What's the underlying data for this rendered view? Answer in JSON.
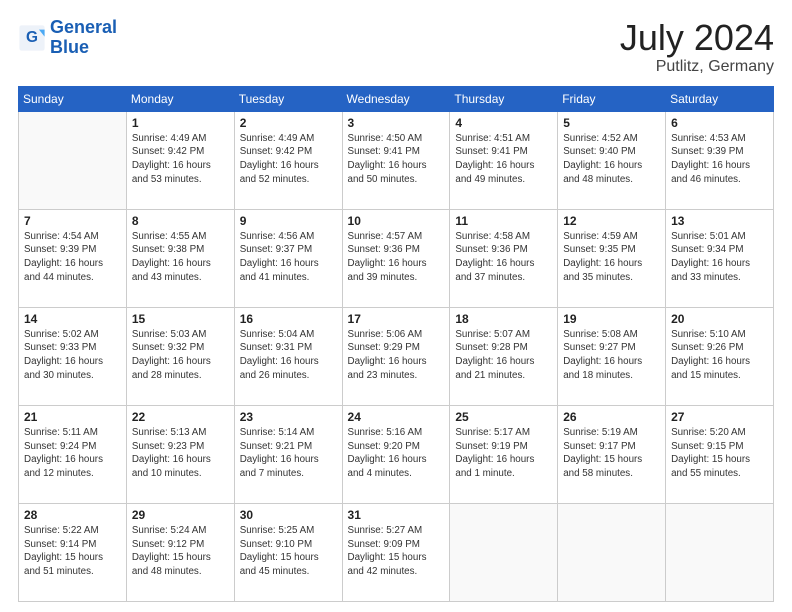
{
  "header": {
    "logo_line1": "General",
    "logo_line2": "Blue",
    "month_year": "July 2024",
    "location": "Putlitz, Germany"
  },
  "weekdays": [
    "Sunday",
    "Monday",
    "Tuesday",
    "Wednesday",
    "Thursday",
    "Friday",
    "Saturday"
  ],
  "weeks": [
    [
      {
        "day": "",
        "info": ""
      },
      {
        "day": "1",
        "info": "Sunrise: 4:49 AM\nSunset: 9:42 PM\nDaylight: 16 hours\nand 53 minutes."
      },
      {
        "day": "2",
        "info": "Sunrise: 4:49 AM\nSunset: 9:42 PM\nDaylight: 16 hours\nand 52 minutes."
      },
      {
        "day": "3",
        "info": "Sunrise: 4:50 AM\nSunset: 9:41 PM\nDaylight: 16 hours\nand 50 minutes."
      },
      {
        "day": "4",
        "info": "Sunrise: 4:51 AM\nSunset: 9:41 PM\nDaylight: 16 hours\nand 49 minutes."
      },
      {
        "day": "5",
        "info": "Sunrise: 4:52 AM\nSunset: 9:40 PM\nDaylight: 16 hours\nand 48 minutes."
      },
      {
        "day": "6",
        "info": "Sunrise: 4:53 AM\nSunset: 9:39 PM\nDaylight: 16 hours\nand 46 minutes."
      }
    ],
    [
      {
        "day": "7",
        "info": "Sunrise: 4:54 AM\nSunset: 9:39 PM\nDaylight: 16 hours\nand 44 minutes."
      },
      {
        "day": "8",
        "info": "Sunrise: 4:55 AM\nSunset: 9:38 PM\nDaylight: 16 hours\nand 43 minutes."
      },
      {
        "day": "9",
        "info": "Sunrise: 4:56 AM\nSunset: 9:37 PM\nDaylight: 16 hours\nand 41 minutes."
      },
      {
        "day": "10",
        "info": "Sunrise: 4:57 AM\nSunset: 9:36 PM\nDaylight: 16 hours\nand 39 minutes."
      },
      {
        "day": "11",
        "info": "Sunrise: 4:58 AM\nSunset: 9:36 PM\nDaylight: 16 hours\nand 37 minutes."
      },
      {
        "day": "12",
        "info": "Sunrise: 4:59 AM\nSunset: 9:35 PM\nDaylight: 16 hours\nand 35 minutes."
      },
      {
        "day": "13",
        "info": "Sunrise: 5:01 AM\nSunset: 9:34 PM\nDaylight: 16 hours\nand 33 minutes."
      }
    ],
    [
      {
        "day": "14",
        "info": "Sunrise: 5:02 AM\nSunset: 9:33 PM\nDaylight: 16 hours\nand 30 minutes."
      },
      {
        "day": "15",
        "info": "Sunrise: 5:03 AM\nSunset: 9:32 PM\nDaylight: 16 hours\nand 28 minutes."
      },
      {
        "day": "16",
        "info": "Sunrise: 5:04 AM\nSunset: 9:31 PM\nDaylight: 16 hours\nand 26 minutes."
      },
      {
        "day": "17",
        "info": "Sunrise: 5:06 AM\nSunset: 9:29 PM\nDaylight: 16 hours\nand 23 minutes."
      },
      {
        "day": "18",
        "info": "Sunrise: 5:07 AM\nSunset: 9:28 PM\nDaylight: 16 hours\nand 21 minutes."
      },
      {
        "day": "19",
        "info": "Sunrise: 5:08 AM\nSunset: 9:27 PM\nDaylight: 16 hours\nand 18 minutes."
      },
      {
        "day": "20",
        "info": "Sunrise: 5:10 AM\nSunset: 9:26 PM\nDaylight: 16 hours\nand 15 minutes."
      }
    ],
    [
      {
        "day": "21",
        "info": "Sunrise: 5:11 AM\nSunset: 9:24 PM\nDaylight: 16 hours\nand 12 minutes."
      },
      {
        "day": "22",
        "info": "Sunrise: 5:13 AM\nSunset: 9:23 PM\nDaylight: 16 hours\nand 10 minutes."
      },
      {
        "day": "23",
        "info": "Sunrise: 5:14 AM\nSunset: 9:21 PM\nDaylight: 16 hours\nand 7 minutes."
      },
      {
        "day": "24",
        "info": "Sunrise: 5:16 AM\nSunset: 9:20 PM\nDaylight: 16 hours\nand 4 minutes."
      },
      {
        "day": "25",
        "info": "Sunrise: 5:17 AM\nSunset: 9:19 PM\nDaylight: 16 hours\nand 1 minute."
      },
      {
        "day": "26",
        "info": "Sunrise: 5:19 AM\nSunset: 9:17 PM\nDaylight: 15 hours\nand 58 minutes."
      },
      {
        "day": "27",
        "info": "Sunrise: 5:20 AM\nSunset: 9:15 PM\nDaylight: 15 hours\nand 55 minutes."
      }
    ],
    [
      {
        "day": "28",
        "info": "Sunrise: 5:22 AM\nSunset: 9:14 PM\nDaylight: 15 hours\nand 51 minutes."
      },
      {
        "day": "29",
        "info": "Sunrise: 5:24 AM\nSunset: 9:12 PM\nDaylight: 15 hours\nand 48 minutes."
      },
      {
        "day": "30",
        "info": "Sunrise: 5:25 AM\nSunset: 9:10 PM\nDaylight: 15 hours\nand 45 minutes."
      },
      {
        "day": "31",
        "info": "Sunrise: 5:27 AM\nSunset: 9:09 PM\nDaylight: 15 hours\nand 42 minutes."
      },
      {
        "day": "",
        "info": ""
      },
      {
        "day": "",
        "info": ""
      },
      {
        "day": "",
        "info": ""
      }
    ]
  ]
}
